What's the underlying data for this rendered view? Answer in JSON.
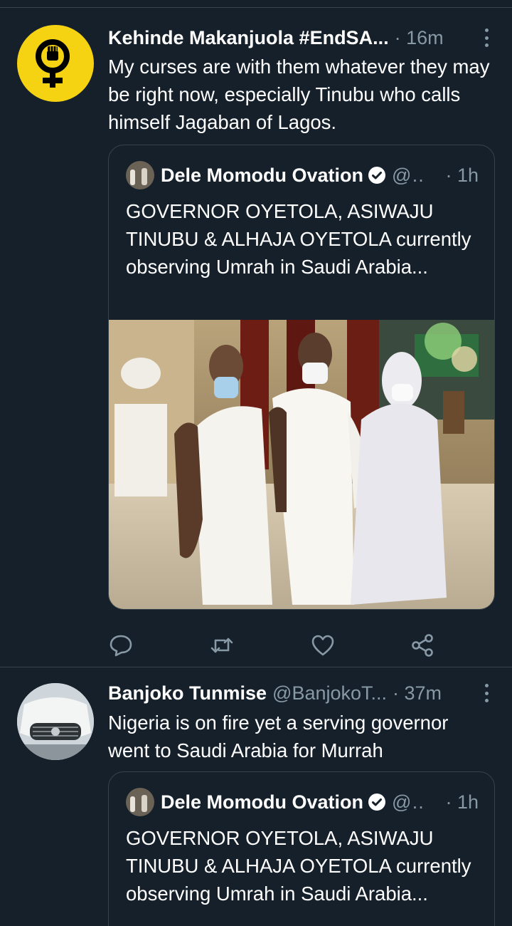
{
  "tweets": [
    {
      "display_name": "Kehinde Makanjuola #EndSA...",
      "handle": "",
      "time": "· 16m",
      "text": "My curses are with them whatever they may be right now, especially Tinubu who calls himself Jagaban of Lagos.",
      "avatar_icon": "feminist-fist-icon",
      "quote": {
        "display_name": "Dele Momodu Ovation",
        "handle": "@...",
        "time": "· 1h",
        "text": "GOVERNOR OYETOLA, ASIWAJU TINUBU & ALHAJA OYETOLA currently observing Umrah in Saudi Arabia..."
      }
    },
    {
      "display_name": "Banjoko Tunmise",
      "handle": "@BanjokoT...",
      "time": "· 37m",
      "text": "Nigeria is on fire yet a serving governor went to Saudi Arabia for Murrah",
      "avatar_icon": "car-photo",
      "quote": {
        "display_name": "Dele Momodu Ovation",
        "handle": "@...",
        "time": "· 1h",
        "text": "GOVERNOR OYETOLA, ASIWAJU TINUBU & ALHAJA OYETOLA currently observing Umrah in Saudi Arabia..."
      }
    }
  ],
  "actions": [
    "reply-icon",
    "retweet-icon",
    "like-icon",
    "share-icon"
  ],
  "colors": {
    "background": "#15202b",
    "divider": "#38444d",
    "secondary_text": "#8899a6",
    "avatar_yellow": "#f5d312"
  }
}
